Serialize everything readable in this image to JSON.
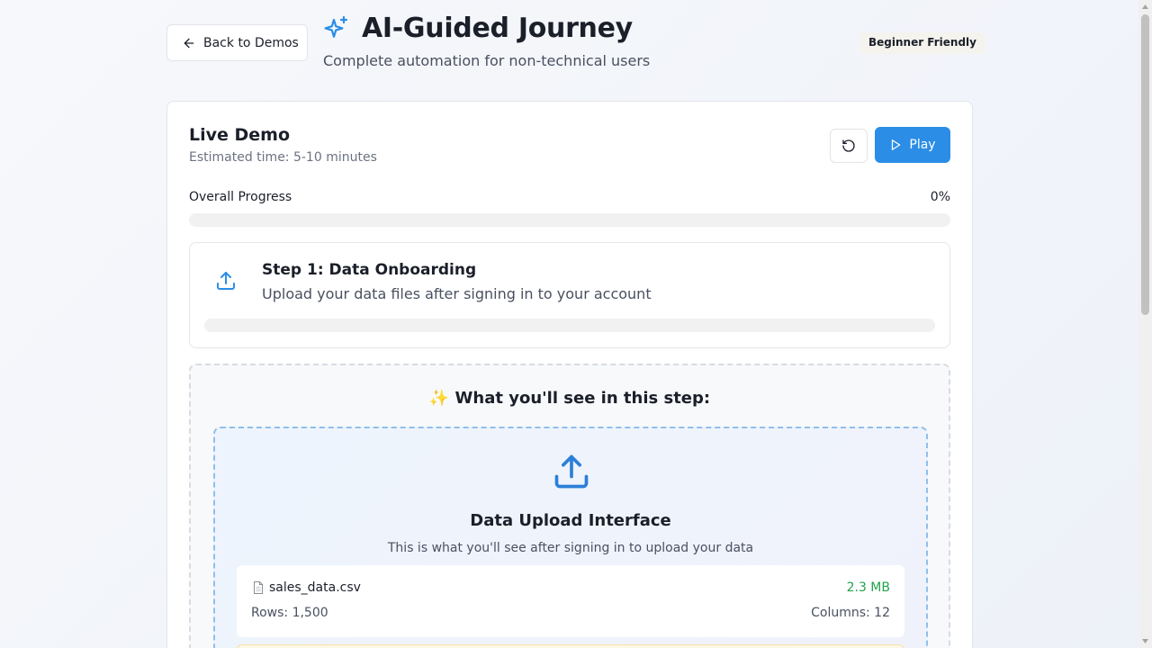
{
  "header": {
    "back_label": "Back to Demos",
    "title": "AI-Guided Journey",
    "subtitle": "Complete automation for non-technical users",
    "badge": "Beginner Friendly"
  },
  "demo": {
    "title": "Live Demo",
    "estimated_time": "Estimated time: 5-10 minutes",
    "play_label": "Play",
    "progress_label": "Overall Progress",
    "progress_value": "0%",
    "progress_fraction": 0
  },
  "step": {
    "title": "Step 1: Data Onboarding",
    "description": "Upload your data files after signing in to your account",
    "progress_fraction": 0
  },
  "preview": {
    "heading": "✨ What you'll see in this step:",
    "upload_title": "Data Upload Interface",
    "upload_description": "This is what you'll see after signing in to upload your data",
    "file": {
      "name": "sales_data.csv",
      "size": "2.3 MB",
      "rows": "Rows: 1,500",
      "columns": "Columns: 12"
    }
  },
  "colors": {
    "accent": "#2b8de6",
    "success": "#22a34a",
    "badge_bg": "#f4f3ee"
  },
  "icons": {
    "back": "arrow-left-icon",
    "title": "sparkles-icon",
    "reset": "rotate-ccw-icon",
    "play": "play-icon",
    "step": "upload-icon",
    "file": "file-icon"
  }
}
